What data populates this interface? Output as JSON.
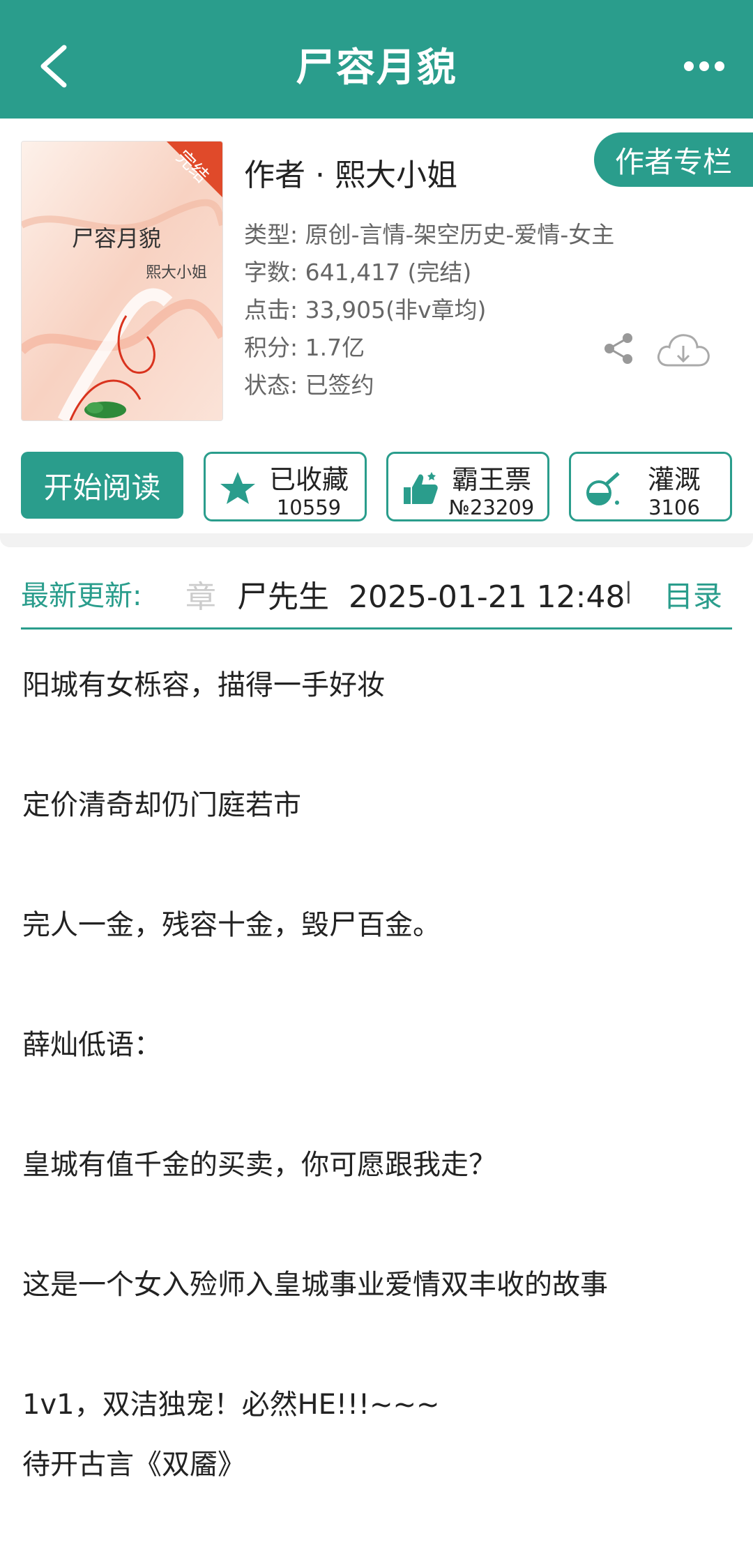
{
  "header": {
    "title": "尸容月貌",
    "back_icon": "chevron-left-icon",
    "more_icon": "more-dots-icon",
    "color": "#2a9d8c"
  },
  "book": {
    "cover_title": "尸容月貌",
    "cover_author": "熙大小姐",
    "cover_badge": "完结",
    "author_line": "作者 · 熙大小姐",
    "author_column_label": "作者专栏",
    "meta": [
      "类型: 原创-言情-架空历史-爱情-女主",
      "字数: 641,417 (完结)",
      "点击: 33,905(非v章均)",
      "积分: 1.7亿",
      "状态: 已签约"
    ]
  },
  "actions": {
    "read_label": "开始阅读",
    "collect": {
      "label": "已收藏",
      "count": "10559",
      "icon": "star-icon"
    },
    "vote": {
      "label": "霸王票",
      "count": "№23209",
      "icon": "thumbs-up-icon"
    },
    "water": {
      "label": "灌溉",
      "count": "3106",
      "icon": "watering-flask-icon"
    }
  },
  "update": {
    "label": "最新更新:",
    "faded_char": "章",
    "chapter": "尸先生",
    "time": "2025-01-21 12:48",
    "separator": "|",
    "toc_label": "目录"
  },
  "description": [
    "阳城有女栎容，描得一手好妆",
    "定价清奇却仍门庭若市",
    "完人一金，残容十金，毁尸百金。",
    "薛灿低语：",
    "皇城有值千金的买卖，你可愿跟我走？",
    "这是一个女入殓师入皇城事业爱情双丰收的故事",
    "1v1，双洁独宠！必然HE!!!~~~",
    "待开古言《双靥》"
  ]
}
